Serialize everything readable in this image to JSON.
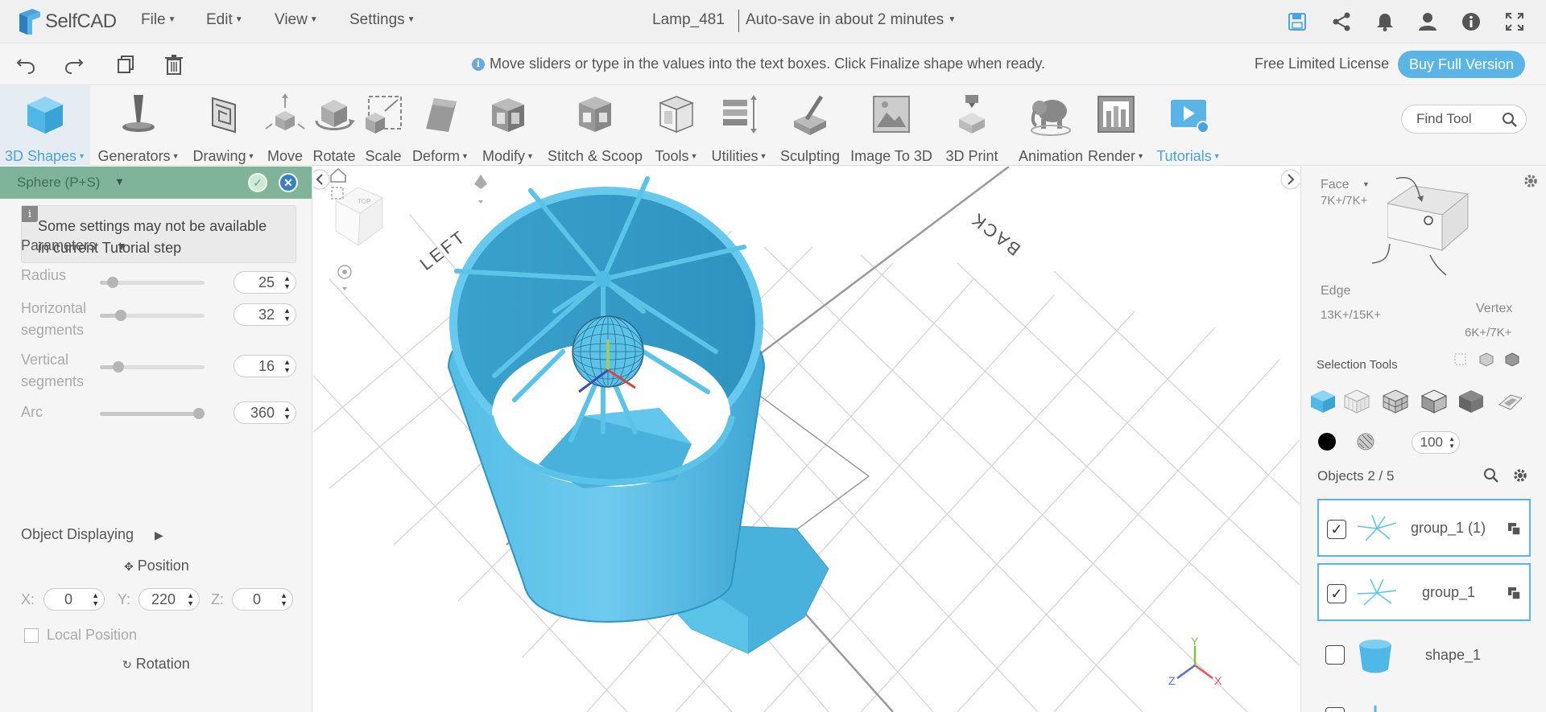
{
  "app": {
    "name": "SelfCAD"
  },
  "menu": {
    "file": "File",
    "edit": "Edit",
    "view": "View",
    "settings": "Settings"
  },
  "document": {
    "title": "Lamp_481",
    "autosave": "Auto-save in about 2 minutes"
  },
  "hint": "Move sliders or type in the values into the text boxes. Click Finalize shape when ready.",
  "license": {
    "label": "Free Limited License",
    "buy_button": "Buy Full Version"
  },
  "toolbar": {
    "tools": [
      {
        "label": "3D Shapes",
        "dropdown": true,
        "active": true
      },
      {
        "label": "Generators",
        "dropdown": true
      },
      {
        "label": "Drawing",
        "dropdown": true
      },
      {
        "label": "Move"
      },
      {
        "label": "Rotate"
      },
      {
        "label": "Scale"
      },
      {
        "label": "Deform",
        "dropdown": true
      },
      {
        "label": "Modify",
        "dropdown": true
      },
      {
        "label": "Stitch & Scoop"
      },
      {
        "label": "Tools",
        "dropdown": true
      },
      {
        "label": "Utilities",
        "dropdown": true
      },
      {
        "label": "Sculpting"
      },
      {
        "label": "Image To 3D"
      },
      {
        "label": "3D Print"
      },
      {
        "label": "Animation"
      },
      {
        "label": "Render",
        "dropdown": true
      },
      {
        "label": "Tutorials",
        "dropdown": true,
        "active": true
      }
    ],
    "find_tool_placeholder": "Find Tool"
  },
  "left_panel": {
    "title": "Sphere (P+S)",
    "tutorial_notice": "Some settings may not be available in current Tutorial step",
    "parameters_title": "Parameters",
    "params": [
      {
        "label": "Radius",
        "value": "25",
        "fraction": 0.12
      },
      {
        "label": "Horizontal segments",
        "value": "32",
        "fraction": 0.2
      },
      {
        "label": "Vertical segments",
        "value": "16",
        "fraction": 0.18
      },
      {
        "label": "Arc",
        "value": "360",
        "fraction": 1.0
      }
    ],
    "object_displaying": "Object Displaying",
    "position_label": "Position",
    "position": {
      "x_label": "X:",
      "x": "0",
      "y_label": "Y:",
      "y": "220",
      "z_label": "Z:",
      "z": "0"
    },
    "local_position": "Local Position",
    "rotation_label": "Rotation"
  },
  "viewport": {
    "labels": {
      "left": "LEFT",
      "back": "BACK"
    },
    "axis": {
      "x": "X",
      "y": "Y",
      "z": "Z"
    },
    "colors": {
      "model": "#5bc3e8",
      "model_dark": "#3aa7cf",
      "grid": "#d0d0d0"
    }
  },
  "right_panel": {
    "face_label": "Face",
    "face_count": "7K+/7K+",
    "edge_label": "Edge",
    "edge_count": "13K+/15K+",
    "vertex_label": "Vertex",
    "vertex_count": "6K+/7K+",
    "selection_tools_title": "Selection Tools",
    "opacity": "100",
    "objects_title": "Objects 2 / 5",
    "objects": [
      {
        "name": "group_1 (1)",
        "checked": true,
        "selected": true
      },
      {
        "name": "group_1",
        "checked": true,
        "selected": true
      },
      {
        "name": "shape_1",
        "checked": false,
        "selected": false
      }
    ]
  },
  "colors": {
    "accent": "#5ab4e6",
    "panel_header": "#7fb39a"
  }
}
